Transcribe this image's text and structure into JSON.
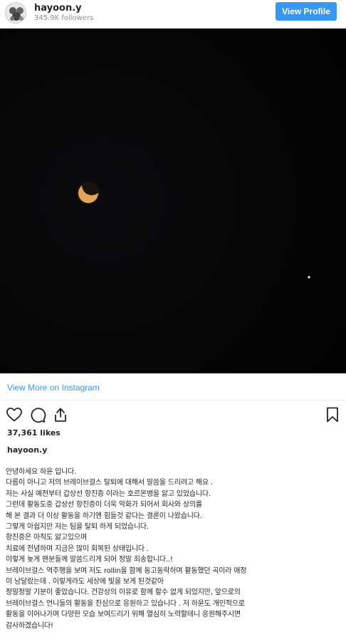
{
  "header": {
    "username": "hayoon.y",
    "followers": "345.9K followers",
    "view_profile_label": "View Profile"
  },
  "photo": {
    "subject": "crescent-moon-night-sky"
  },
  "links": {
    "view_more": "View More on Instagram"
  },
  "actions": {
    "icons": [
      "heart-icon",
      "comment-icon",
      "share-icon",
      "bookmark-icon"
    ]
  },
  "post": {
    "likes": "37,361 likes",
    "username": "hayoon.y",
    "caption_lines": [
      "안녕하세요 하윤 입니다.",
      "다름이 아니고 저의 브레이브걸스 탈퇴에 대해서 말씀을 드리려고 해요 .",
      "저는 사실 예전부터 갑상선 항진증 이라는 호르몬병을 앓고 있었습니다.",
      "그런데 활동도중 갑상선 항진증이 더욱 악화가 되어서 회사와 상의를",
      "해 본 결과 더 이상 활동을 하기엔 힘들것 같다는 결론이 나왔습니다.",
      "그렇게 아쉽지만 저는 팀을 탈퇴 하게 되었습니다.",
      "항진증은 아직도 앓고있으며",
      "치료에 전념하며 지금은 많이 회복된 상태입니다 .",
      "이렇게 늦게 팬분들께 말씀드리게 되어 정말 죄송합니다..!",
      "브레이브걸스 역주행을 보며 저도 rollin을 함께 동고동락하며 활동했던 곡이라 애정",
      "이 남달랐는데 . 이렇게라도 세상에 빛을 보게 된것같아",
      "정말정말 기분이 좋았습니다. 건강상의 이유로 함께 할수 없게 되었지만, 앞으로의",
      "브레이브걸스 언니들의 활동을 진심으로 응원하고 있습니다 . 저 하윤도 개인적으로",
      "활동을 이어나가며 다양한 모습 보여드리기 위해 열심히 노력할테니 응원해주시면",
      "감사하겠습니다!"
    ]
  },
  "colors": {
    "accent": "#3897f0",
    "text": "#262626",
    "muted": "#8e8e8e",
    "moon": "#e0a65a",
    "sky": "#050505"
  }
}
